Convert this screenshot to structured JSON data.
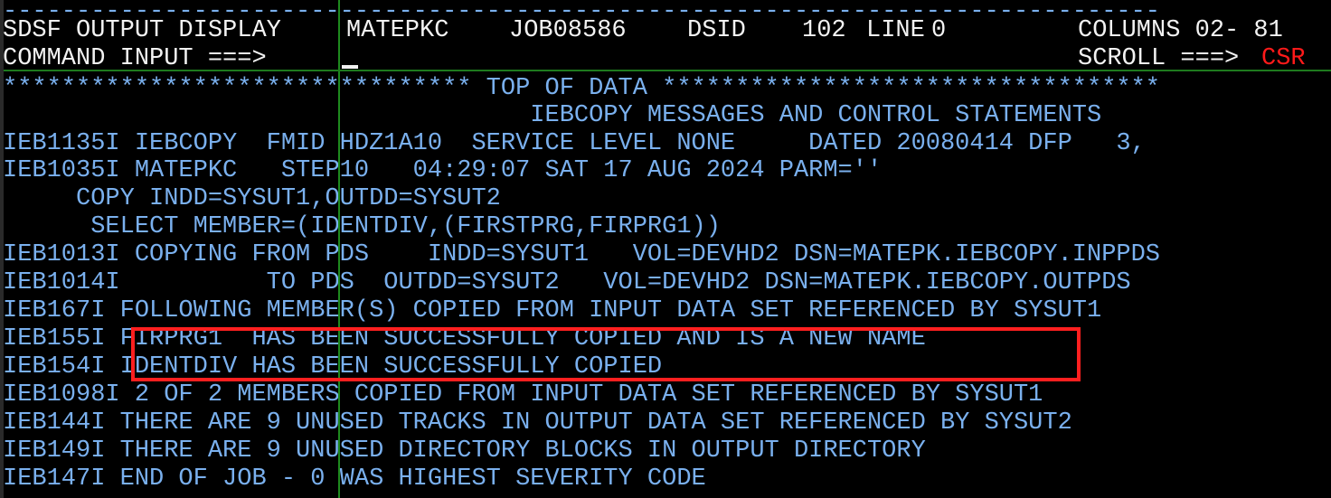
{
  "terminal": {
    "title": "SDSF OUTPUT DISPLAY",
    "colors": {
      "background": "#000000",
      "header_text": "#f2f2f2",
      "body_text": "#7ab0ee",
      "field_separator": "#1e8a1e",
      "highlight_box": "#ff1f1f",
      "accent_red": "#ff1a1a"
    }
  },
  "header": {
    "ruler_line": "-------------------------------------------------------------------------------",
    "title": "SDSF OUTPUT DISPLAY",
    "jobname": "MATEPKC",
    "jobid": "JOB08586",
    "dsid_label": "DSID",
    "dsid_value": "102",
    "line_label": "LINE",
    "line_value": "0",
    "columns_label": "COLUMNS",
    "columns_value": "02- 81",
    "columns_full": "COLUMNS 02- 81",
    "title_row_full": "SDSF OUTPUT DISPLAY MATEPKC  JOB08586  DSID    102 LINE 0",
    "command_label": "COMMAND INPUT ===>",
    "command_value": "",
    "scroll_label": "SCROLL ===>",
    "scroll_value": "CSR"
  },
  "body": {
    "top_of_data": "******************************** TOP OF DATA **********************************",
    "lines": [
      {
        "id": "line-banner",
        "text": "                                    IEBCOPY MESSAGES AND CONTROL STATEMENTS"
      },
      {
        "id": "line-ieb1135i",
        "text": "IEB1135I IEBCOPY  FMID HDZ1A10  SERVICE LEVEL NONE     DATED 20080414 DFP   3,"
      },
      {
        "id": "line-ieb1035i",
        "text": "IEB1035I MATEPKC   STEP10   04:29:07 SAT 17 AUG 2024 PARM=''"
      },
      {
        "id": "line-copy",
        "text": "     COPY INDD=SYSUT1,OUTDD=SYSUT2"
      },
      {
        "id": "line-select",
        "text": "      SELECT MEMBER=(IDENTDIV,(FIRSTPRG,FIRPRG1))"
      },
      {
        "id": "line-ieb1013i",
        "text": "IEB1013I COPYING FROM PDS    INDD=SYSUT1   VOL=DEVHD2 DSN=MATEPK.IEBCOPY.INPPDS"
      },
      {
        "id": "line-ieb1014i",
        "text": "IEB1014I          TO PDS  OUTDD=SYSUT2   VOL=DEVHD2 DSN=MATEPK.IEBCOPY.OUTPDS"
      },
      {
        "id": "line-ieb167i",
        "text": "IEB167I FOLLOWING MEMBER(S) COPIED FROM INPUT DATA SET REFERENCED BY SYSUT1"
      },
      {
        "id": "line-ieb155i",
        "text": "IEB155I FIRPRG1  HAS BEEN SUCCESSFULLY COPIED AND IS A NEW NAME"
      },
      {
        "id": "line-ieb154i",
        "text": "IEB154I IDENTDIV HAS BEEN SUCCESSFULLY COPIED"
      },
      {
        "id": "line-ieb1098i",
        "text": "IEB1098I 2 OF 2 MEMBERS COPIED FROM INPUT DATA SET REFERENCED BY SYSUT1"
      },
      {
        "id": "line-ieb144i",
        "text": "IEB144I THERE ARE 9 UNUSED TRACKS IN OUTPUT DATA SET REFERENCED BY SYSUT2"
      },
      {
        "id": "line-ieb149i",
        "text": "IEB149I THERE ARE 9 UNUSED DIRECTORY BLOCKS IN OUTPUT DIRECTORY"
      },
      {
        "id": "line-ieb147i",
        "text": "IEB147I END OF JOB - 0 WAS HIGHEST SEVERITY CODE"
      }
    ]
  },
  "annotation": {
    "highlight_note": "red rectangle around the two successful-copy messages",
    "highlighted_lines": [
      "FIRPRG1  HAS BEEN SUCCESSFULLY COPIED AND IS A NEW NAME",
      "IDENTDIV HAS BEEN SUCCESSFULLY COPIED"
    ]
  }
}
